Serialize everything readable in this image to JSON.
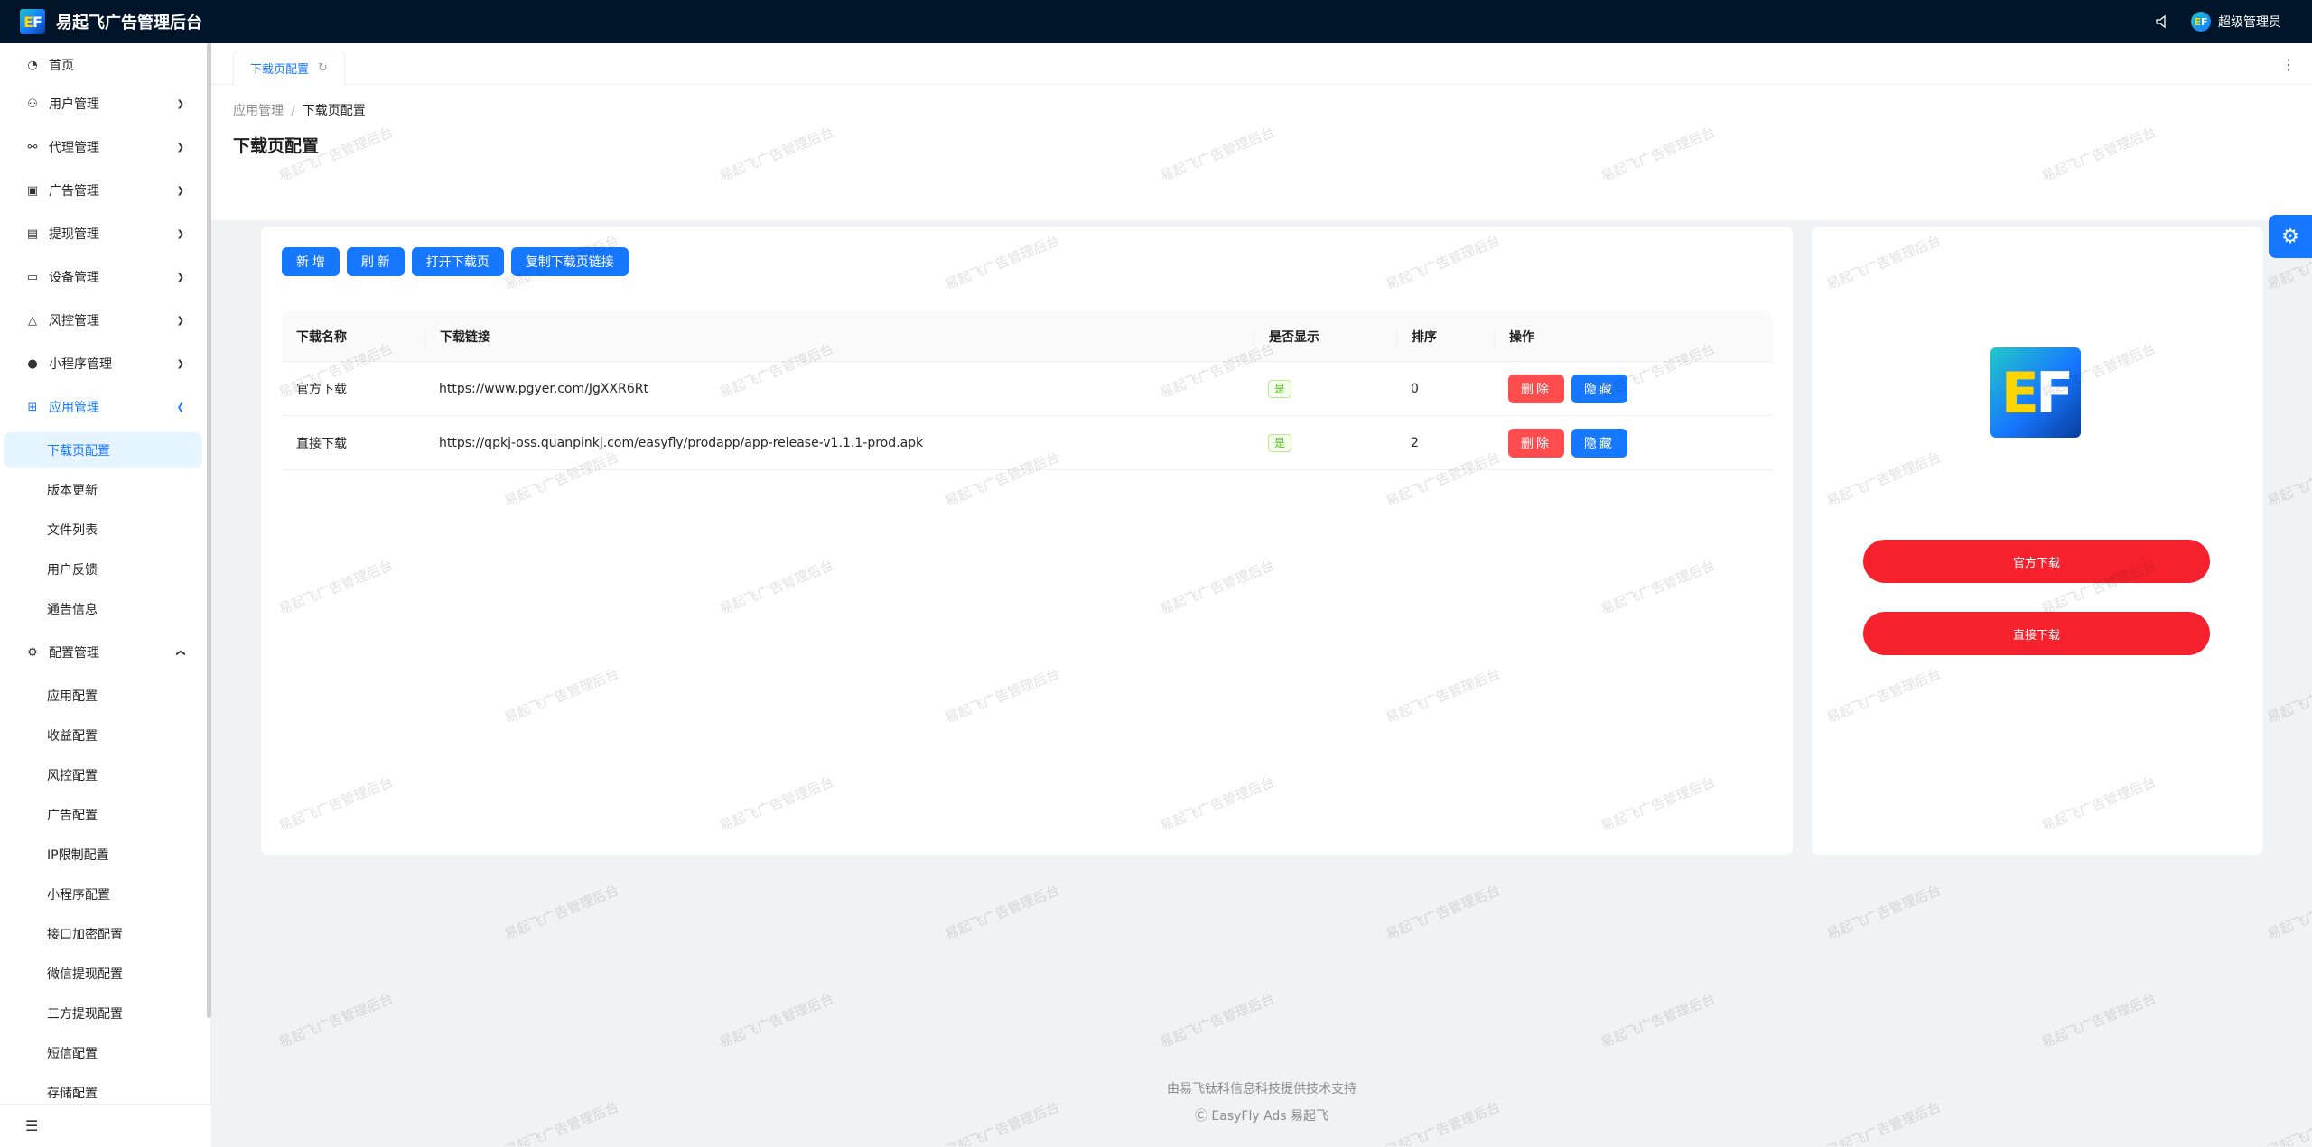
{
  "app": {
    "logo_e": "E",
    "logo_f": "F",
    "title": "易起飞广告管理后台",
    "bell_icon": "bell-icon",
    "user_name": "超级管理员"
  },
  "sidebar": {
    "items": [
      {
        "label": "首页",
        "icon": "dashboard-icon"
      },
      {
        "label": "用户管理",
        "icon": "user-icon"
      },
      {
        "label": "代理管理",
        "icon": "agent-icon"
      },
      {
        "label": "广告管理",
        "icon": "ad-icon"
      },
      {
        "label": "提现管理",
        "icon": "withdraw-icon"
      },
      {
        "label": "设备管理",
        "icon": "monitor-icon"
      },
      {
        "label": "风控管理",
        "icon": "warning-icon"
      },
      {
        "label": "小程序管理",
        "icon": "wechat-icon"
      },
      {
        "label": "应用管理",
        "icon": "apps-icon"
      },
      {
        "label": "配置管理",
        "icon": "gear-icon"
      }
    ],
    "app_sub": [
      "下载页配置",
      "版本更新",
      "文件列表",
      "用户反馈",
      "通告信息"
    ],
    "config_sub": [
      "应用配置",
      "收益配置",
      "风控配置",
      "广告配置",
      "IP限制配置",
      "小程序配置",
      "接口加密配置",
      "微信提现配置",
      "三方提现配置",
      "短信配置",
      "存储配置"
    ]
  },
  "tabs": {
    "active": "下载页配置"
  },
  "breadcrumb": {
    "parent": "应用管理",
    "current": "下载页配置"
  },
  "page": {
    "title": "下载页配置"
  },
  "toolbar": {
    "add": "新 增",
    "refresh": "刷 新",
    "open": "打开下载页",
    "copy": "复制下载页链接"
  },
  "table": {
    "columns": [
      "下载名称",
      "下载链接",
      "是否显示",
      "排序",
      "操作"
    ],
    "rows": [
      {
        "name": "官方下载",
        "link": "https://www.pgyer.com/JgXXR6Rt",
        "show": "是",
        "order": "0",
        "delete": "删除",
        "hide": "隐藏"
      },
      {
        "name": "直接下载",
        "link": "https://qpkj-oss.quanpinkj.com/easyfly/prodapp/app-release-v1.1.1-prod.apk",
        "show": "是",
        "order": "2",
        "delete": "删除",
        "hide": "隐藏"
      }
    ]
  },
  "preview": {
    "logo_e": "E",
    "logo_f": "F",
    "buttons": [
      "官方下载",
      "直接下载"
    ],
    "button_color": "#f5222d"
  },
  "footer": {
    "line1": "由易飞钛科信息科技提供技术支持",
    "line2": "Ⓒ EasyFly Ads 易起飞"
  },
  "watermark": "易起飞广告管理后台",
  "colors": {
    "primary": "#1677ff",
    "header_bg": "#001529",
    "danger": "#ff4d4f"
  }
}
